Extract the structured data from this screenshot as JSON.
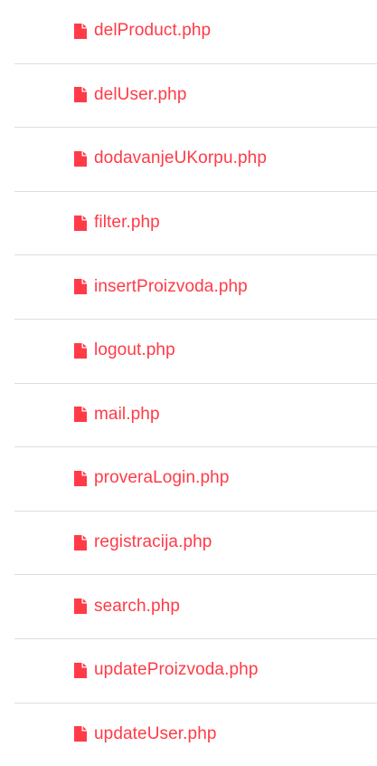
{
  "files": {
    "items": [
      {
        "label": "delProduct.php",
        "icon": "file-icon"
      },
      {
        "label": "delUser.php",
        "icon": "file-icon"
      },
      {
        "label": "dodavanjeUKorpu.php",
        "icon": "file-icon"
      },
      {
        "label": "filter.php",
        "icon": "file-icon"
      },
      {
        "label": "insertProizvoda.php",
        "icon": "file-icon"
      },
      {
        "label": "logout.php",
        "icon": "file-icon"
      },
      {
        "label": "mail.php",
        "icon": "file-icon"
      },
      {
        "label": "proveraLogin.php",
        "icon": "file-icon"
      },
      {
        "label": "registracija.php",
        "icon": "file-icon"
      },
      {
        "label": "search.php",
        "icon": "file-icon"
      },
      {
        "label": "updateProizvoda.php",
        "icon": "file-icon"
      },
      {
        "label": "updateUser.php",
        "icon": "file-icon"
      }
    ]
  },
  "colors": {
    "link": "#ff3b47",
    "divider": "#dedede",
    "background": "#ffffff"
  }
}
